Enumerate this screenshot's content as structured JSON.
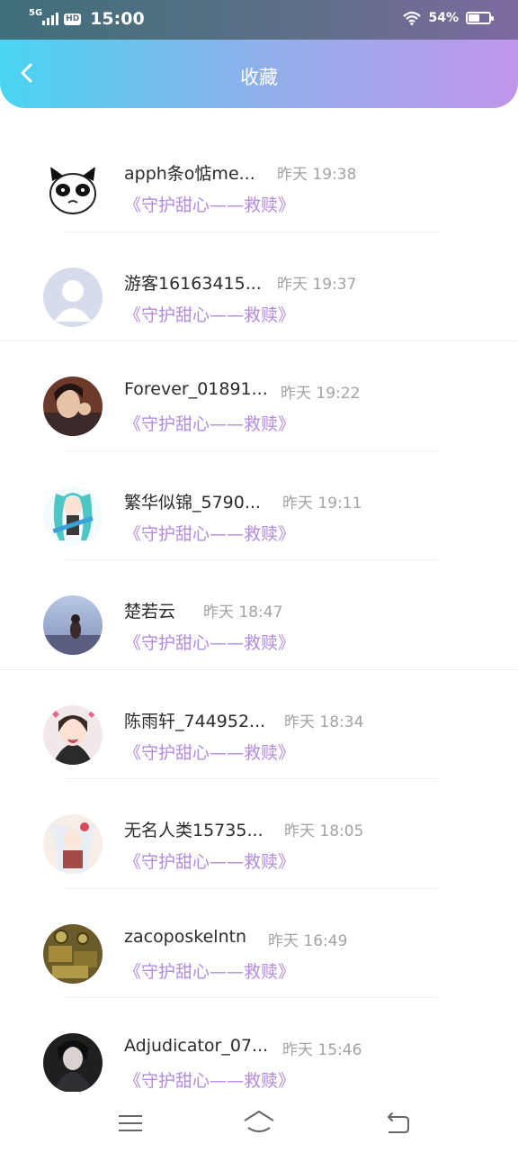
{
  "status_bar": {
    "network": "5G",
    "hd": "HD",
    "time": "15:00",
    "battery_percent": "54%",
    "battery_level": 0.54
  },
  "header": {
    "title": "收藏"
  },
  "favorites": [
    {
      "name": "apph条o惦me...",
      "time": "昨天 19:38",
      "work": "《守护甜心——救赎》"
    },
    {
      "name": "游客16163415...",
      "time": "昨天 19:37",
      "work": "《守护甜心——救赎》"
    },
    {
      "name": "Forever_01891...",
      "time": "昨天 19:22",
      "work": "《守护甜心——救赎》"
    },
    {
      "name": "繁华似锦_5790...",
      "time": "昨天 19:11",
      "work": "《守护甜心——救赎》"
    },
    {
      "name": "楚若云",
      "time": "昨天 18:47",
      "work": "《守护甜心——救赎》"
    },
    {
      "name": "陈雨轩_744952...",
      "time": "昨天 18:34",
      "work": "《守护甜心——救赎》"
    },
    {
      "name": "无名人类15735...",
      "time": "昨天 18:05",
      "work": "《守护甜心——救赎》"
    },
    {
      "name": "zacoposkelntn",
      "time": "昨天 16:49",
      "work": "《守护甜心——救赎》"
    },
    {
      "name": "Adjudicator_07...",
      "time": "昨天 15:46",
      "work": "《守护甜心——救赎》"
    }
  ],
  "colors": {
    "accent_purple": "#b28be0",
    "header_gradient_start": "#49d4f2",
    "header_gradient_end": "#c096ea"
  }
}
